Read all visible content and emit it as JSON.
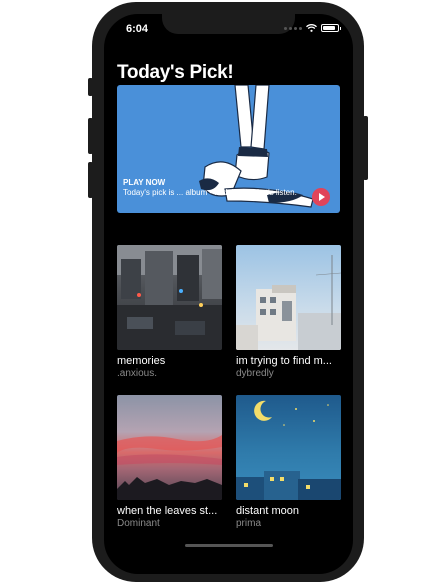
{
  "status_bar": {
    "time": "6:04",
    "battery_level": 0.85,
    "icons": [
      "signal-icon",
      "wifi-icon",
      "battery-icon"
    ]
  },
  "header": {
    "title": "Today's Pick!"
  },
  "featured": {
    "kicker": "PLAY NOW",
    "description": "Today's pick is ... album - midnight C. Let's listen.",
    "accent_color": "#4a90d9",
    "play_button_color": "#e0445a"
  },
  "albums": [
    {
      "title": "memories",
      "artist": ".anxious."
    },
    {
      "title": "im trying to find m...",
      "artist": "dybredly"
    },
    {
      "title": "when the leaves st...",
      "artist": "Dominant"
    },
    {
      "title": "distant moon",
      "artist": "prima"
    }
  ]
}
